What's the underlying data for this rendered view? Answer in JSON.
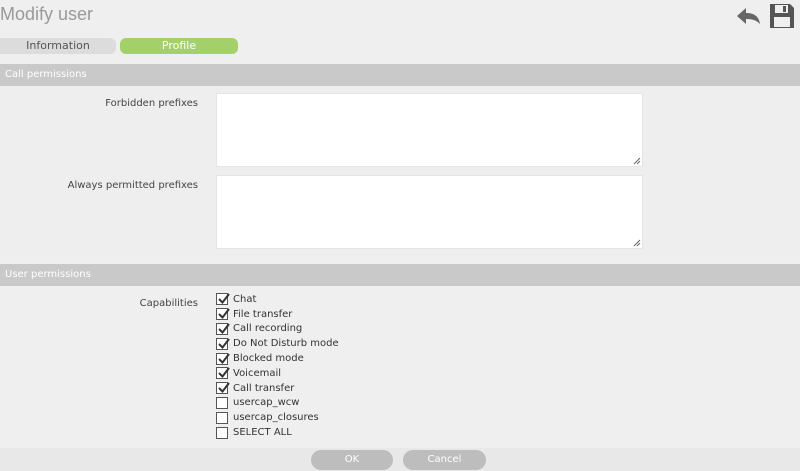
{
  "header": {
    "title": "Modify user",
    "back_icon": "undo-arrow-icon",
    "save_icon": "floppy-disk-icon"
  },
  "tabs": [
    {
      "label": "Information",
      "active": false
    },
    {
      "label": "Profile",
      "active": true
    }
  ],
  "call_permissions": {
    "title": "Call permissions",
    "forbidden_label": "Forbidden prefixes",
    "forbidden_value": "",
    "permitted_label": "Always permitted prefixes",
    "permitted_value": ""
  },
  "user_permissions": {
    "title": "User permissions",
    "capabilities_label": "Capabilities",
    "capabilities": [
      {
        "label": "Chat",
        "checked": true
      },
      {
        "label": "File transfer",
        "checked": true
      },
      {
        "label": "Call recording",
        "checked": true
      },
      {
        "label": "Do Not Disturb mode",
        "checked": true
      },
      {
        "label": "Blocked mode",
        "checked": true
      },
      {
        "label": "Voicemail",
        "checked": true
      },
      {
        "label": "Call transfer",
        "checked": true
      },
      {
        "label": "usercap_wcw",
        "checked": false
      },
      {
        "label": "usercap_closures",
        "checked": false
      },
      {
        "label": "SELECT ALL",
        "checked": false
      }
    ]
  },
  "footer": {
    "ok_label": "OK",
    "cancel_label": "Cancel"
  },
  "colors": {
    "accent_green": "#a3d06a",
    "section_header": "#c9c9c9",
    "button_gray": "#bdbdbd"
  }
}
